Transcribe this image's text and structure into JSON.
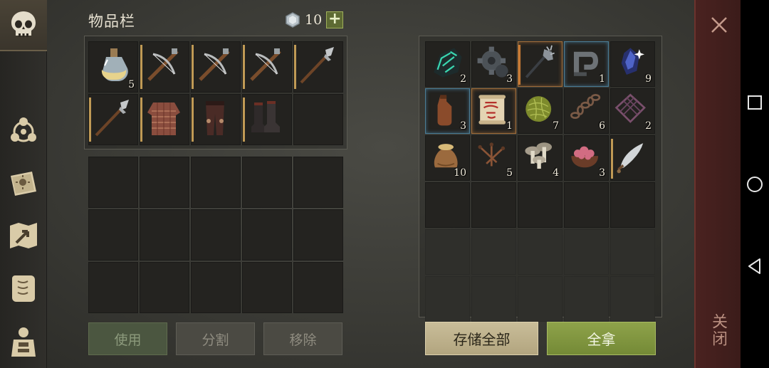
{
  "inventory": {
    "title": "物品栏",
    "currency_value": "10",
    "currency_icon": "silver-gem-icon",
    "add_icon": "plus-icon",
    "slots": [
      {
        "icon": "potion-flask-icon",
        "qty": "5"
      },
      {
        "icon": "crossbow-icon",
        "qty": ""
      },
      {
        "icon": "crossbow-icon",
        "qty": ""
      },
      {
        "icon": "crossbow-icon",
        "qty": ""
      },
      {
        "icon": "halberd-icon",
        "qty": ""
      },
      {
        "icon": "halberd-icon",
        "qty": ""
      },
      {
        "icon": "chainmail-shirt-icon",
        "qty": ""
      },
      {
        "icon": "leather-pants-icon",
        "qty": ""
      },
      {
        "icon": "boots-icon",
        "qty": ""
      }
    ]
  },
  "storage": {
    "slots": [
      {
        "icon": "green-crystal-ore-icon",
        "qty": "2"
      },
      {
        "icon": "gear-cog-icon",
        "qty": "3"
      },
      {
        "icon": "mace-staff-icon",
        "qty": ""
      },
      {
        "icon": "iron-clamp-icon",
        "qty": "1"
      },
      {
        "icon": "blue-gem-icon",
        "qty": "9"
      },
      {
        "icon": "leather-bottle-icon",
        "qty": "3"
      },
      {
        "icon": "map-scroll-icon",
        "qty": "1"
      },
      {
        "icon": "fiber-ball-icon",
        "qty": "7"
      },
      {
        "icon": "iron-chain-icon",
        "qty": "6"
      },
      {
        "icon": "metal-grate-icon",
        "qty": "2"
      },
      {
        "icon": "grain-sack-icon",
        "qty": "10"
      },
      {
        "icon": "nails-icon",
        "qty": "5"
      },
      {
        "icon": "mushrooms-icon",
        "qty": "4"
      },
      {
        "icon": "meat-bowl-icon",
        "qty": "3"
      },
      {
        "icon": "scimitar-icon",
        "qty": ""
      }
    ]
  },
  "buttons": {
    "use": "使用",
    "split": "分割",
    "remove": "移除",
    "store_all": "存储全部",
    "take_all": "全拿"
  },
  "close": {
    "label": "关闭",
    "icon": "close-icon"
  },
  "sidebar": {
    "items": [
      "skull-icon",
      "crafting-triangle-icon",
      "sun-journal-icon",
      "map-arrow-icon",
      "quest-scroll-icon",
      "character-body-icon"
    ]
  },
  "android_nav": [
    "recent-apps-icon",
    "home-icon",
    "back-icon"
  ]
}
